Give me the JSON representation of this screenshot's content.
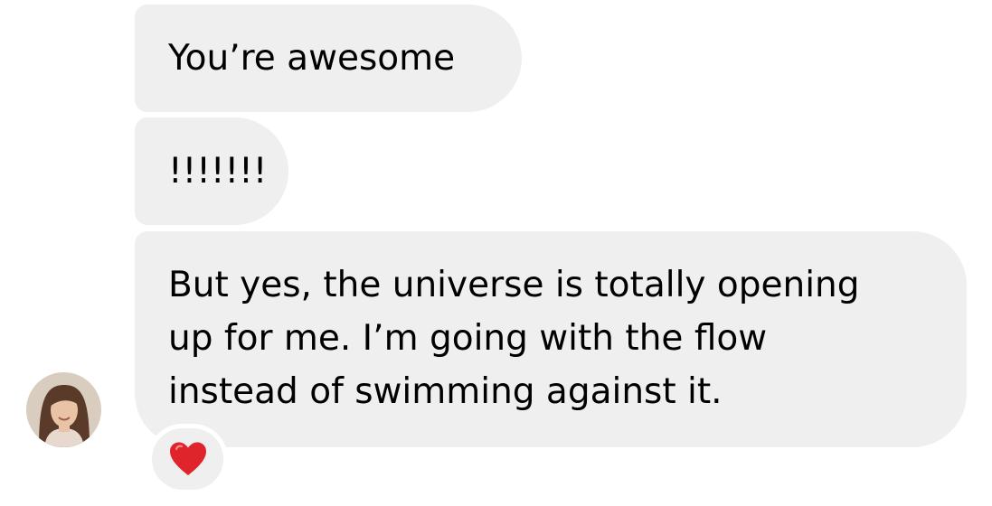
{
  "messages": [
    {
      "lines": [
        "You’re awesome"
      ]
    },
    {
      "lines": [
        "!!!!!!!"
      ]
    },
    {
      "lines": [
        "But yes, the universe is totally opening",
        "up for me. I’m going with the flow",
        "instead of swimming against it."
      ]
    }
  ],
  "reaction": {
    "icon": "red-heart-icon",
    "color": "#e0242b"
  },
  "avatar": {
    "icon": "contact-avatar"
  },
  "colors": {
    "bubble": "#efeff0",
    "text": "#000000"
  }
}
